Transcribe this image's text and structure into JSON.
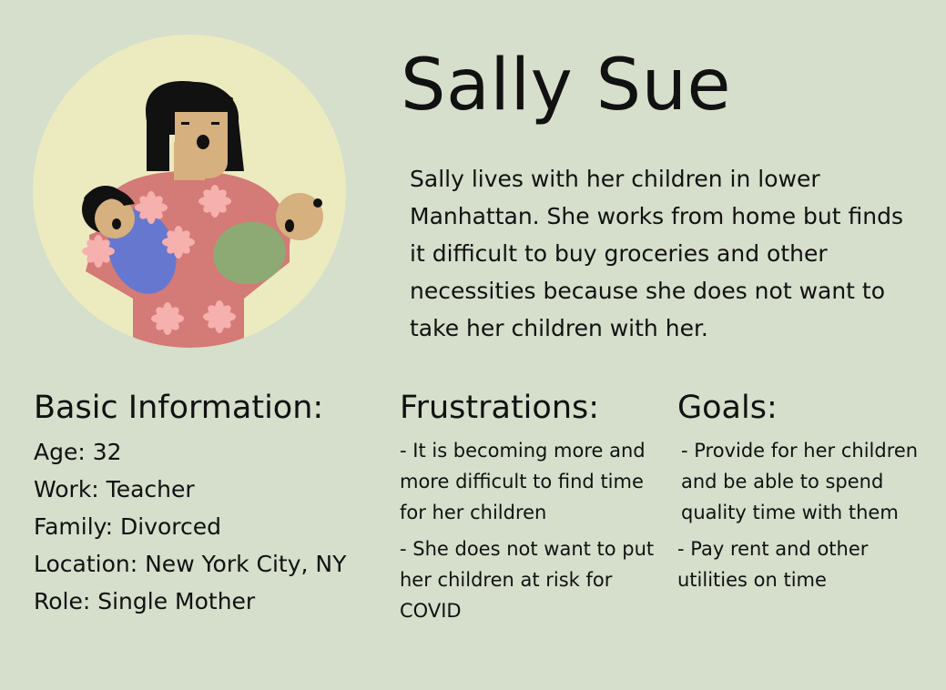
{
  "persona": {
    "name": "Sally Sue",
    "bio": "Sally lives with her children in lower Manhattan. She works from home but finds it difficult to buy groceries and other necessities because she does not want to take her children with her."
  },
  "basic_info": {
    "heading": "Basic Information:",
    "items": [
      "Age: 32",
      "Work: Teacher",
      "Family: Divorced",
      "Location: New York City, NY",
      "Role: Single Mother"
    ]
  },
  "frustrations": {
    "heading": "Frustrations:",
    "items": [
      "- It is becoming more and more difficult to find time for her children",
      "- She does not want to put her children at risk for COVID"
    ]
  },
  "goals": {
    "heading": "Goals:",
    "items": [
      "- Provide for her children and be able to spend quality time with them",
      "- Pay rent and other utilities on time"
    ]
  },
  "colors": {
    "background": "#d5dfcc",
    "avatar_circle": "#ecebbf",
    "shirt": "#d47a77",
    "flower": "#f6b0ae",
    "skin": "#d6b07e",
    "hair": "#111111",
    "blue_baby": "#6677d0",
    "green_baby": "#8eaa74"
  }
}
